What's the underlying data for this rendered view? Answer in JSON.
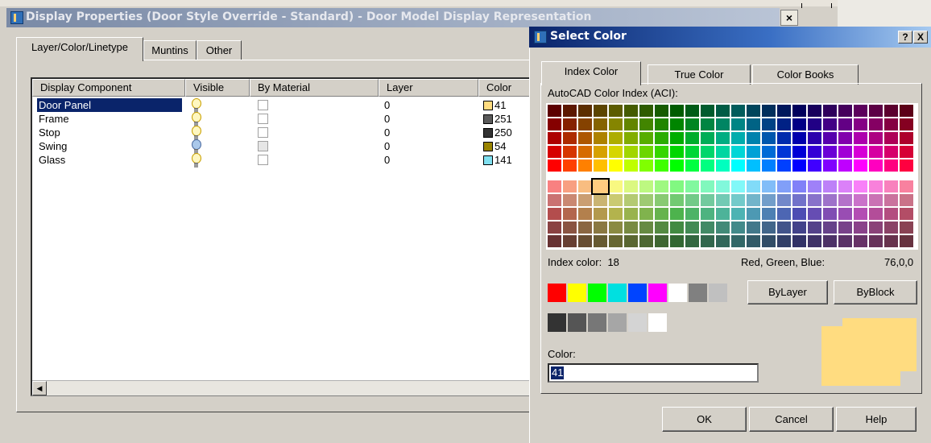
{
  "background_dialog": {
    "title": "Display Properties (Door Style Override - Standard) - Door Model Display Representation",
    "tabs": [
      "Layer/Color/Linetype",
      "Muntins",
      "Other"
    ],
    "columns": [
      "Display Component",
      "Visible",
      "By Material",
      "Layer",
      "Color"
    ],
    "rows": [
      {
        "component": "Door Panel",
        "visible": "on",
        "by_material": false,
        "layer": "0",
        "color": "41",
        "swatch": "#ffdc80",
        "selected": true
      },
      {
        "component": "Frame",
        "visible": "on",
        "by_material": false,
        "layer": "0",
        "color": "251",
        "swatch": "#5a5a5a",
        "selected": false
      },
      {
        "component": "Stop",
        "visible": "on",
        "by_material": false,
        "layer": "0",
        "color": "250",
        "swatch": "#333333",
        "selected": false
      },
      {
        "component": "Swing",
        "visible": "off",
        "by_material": false,
        "layer": "0",
        "color": "54",
        "swatch": "#9a8400",
        "selected": false
      },
      {
        "component": "Glass",
        "visible": "on",
        "by_material": false,
        "layer": "0",
        "color": "141",
        "swatch": "#80e0f0",
        "selected": false
      }
    ]
  },
  "select_color": {
    "title": "Select Color",
    "title_buttons": [
      "?",
      "X"
    ],
    "tabs": [
      "Index Color",
      "True Color",
      "Color Books"
    ],
    "active_tab": "Index Color",
    "aci_label": "AutoCAD Color Index (ACI):",
    "index_color_label": "Index color:",
    "index_color_value": "18",
    "rgb_label": "Red, Green, Blue:",
    "rgb_value": "76,0,0",
    "selected_palette_color": "#ffcc80",
    "standard_colors": [
      "#ff0000",
      "#ffff00",
      "#00ff00",
      "#00e0e0",
      "#0044ff",
      "#ff00ff",
      "#ffffff",
      "#808080",
      "#c0c0c0"
    ],
    "gray_colors": [
      "#333333",
      "#555555",
      "#777777",
      "#a6a6a6",
      "#d4d4d4",
      "#ffffff"
    ],
    "bylayer_label": "ByLayer",
    "byblock_label": "ByBlock",
    "color_field_label": "Color:",
    "color_field_value": "41",
    "preview_color": "#ffdc80",
    "buttons": {
      "ok": "OK",
      "cancel": "Cancel",
      "help": "Help"
    }
  }
}
